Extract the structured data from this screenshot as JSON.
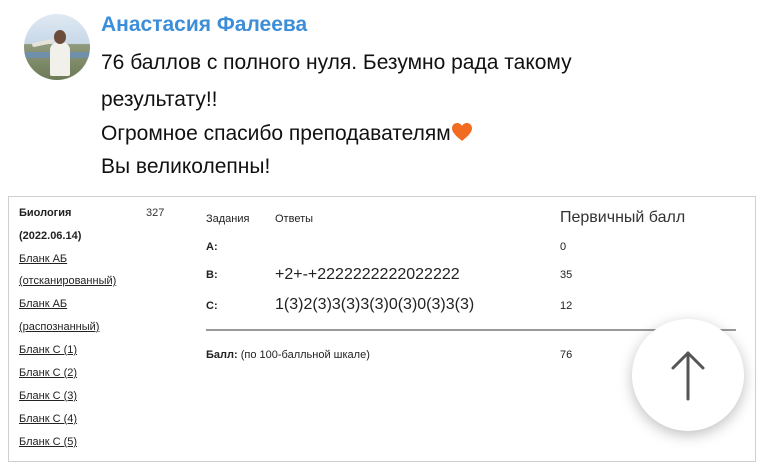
{
  "post": {
    "author": "Анастасия Фалеева",
    "lines": [
      "76 баллов с полного нуля. Безумно рада такому",
      "результату!!",
      "Огромное спасибо преподавателям",
      "Вы великолепны!"
    ]
  },
  "card": {
    "subject": "Биология",
    "date": "(2022.06.14)",
    "total": "327",
    "links": [
      "Бланк АБ",
      "(отсканированный)",
      "Бланк АБ",
      "(распознанный)",
      "Бланк С (1)",
      "Бланк С (2)",
      "Бланк С (3)",
      "Бланк С (4)",
      "Бланк С (5)"
    ],
    "headers": {
      "tasks": "Задания",
      "answers": "Ответы",
      "primary": "Первичный балл"
    },
    "rows": [
      {
        "part": "A:",
        "answer": "",
        "score": "0"
      },
      {
        "part": "B:",
        "answer": "+2+-+2222222222022222",
        "score": "35"
      },
      {
        "part": "C:",
        "answer": "1(3)2(3)3(3)3(3)0(3)0(3)3(3)",
        "score": "12"
      }
    ],
    "final_label": "Балл:",
    "final_note": "(по 100-балльной шкале)",
    "final_score": "76"
  },
  "icons": {
    "heart": "orange-heart-emoji",
    "scroll_up": "arrow-up-icon"
  },
  "colors": {
    "author": "#3d8ed8",
    "heart": "#f26b21"
  }
}
